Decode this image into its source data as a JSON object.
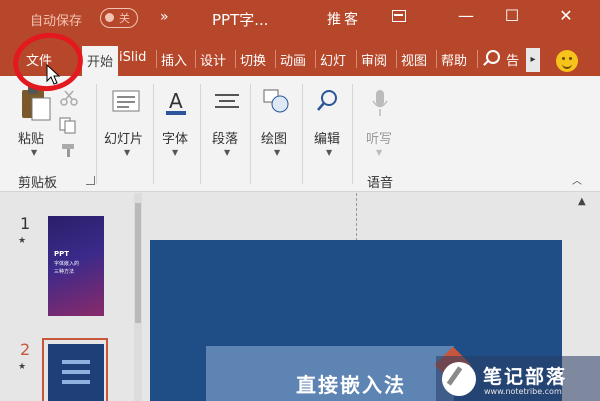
{
  "titlebar": {
    "autosave_label": "自动保存",
    "autosave_state": "关",
    "doc_title": "PPT字...",
    "user_name": "推客",
    "controls": [
      "ribbon-display-options",
      "minimize",
      "maximize",
      "close"
    ]
  },
  "ribbon_tabs": {
    "items": [
      "文件",
      "开始",
      "iSlid",
      "插入",
      "设计",
      "切换",
      "动画",
      "幻灯",
      "审阅",
      "视图",
      "帮助"
    ],
    "active": "开始",
    "search_hint": "告",
    "scroll_glyph": "▸"
  },
  "ribbon": {
    "clipboard": {
      "paste": "粘贴",
      "group": "剪贴板"
    },
    "slides": "幻灯片",
    "font": "字体",
    "paragraph": "段落",
    "drawing": "绘图",
    "editing": "编辑",
    "dictate": "听写",
    "voice_group": "语音"
  },
  "thumbnails": [
    {
      "number": "1",
      "lines": [
        "PPT",
        "字体嵌入的",
        "三种方法"
      ]
    },
    {
      "number": "2"
    }
  ],
  "slide": {
    "text": "直接嵌入法"
  },
  "watermark": {
    "text": "笔记部落",
    "url": "www.notetribe.com"
  },
  "colors": {
    "accent": "#b7472a",
    "highlight": "#e3191f",
    "slide_bg": "#1f4e86"
  }
}
